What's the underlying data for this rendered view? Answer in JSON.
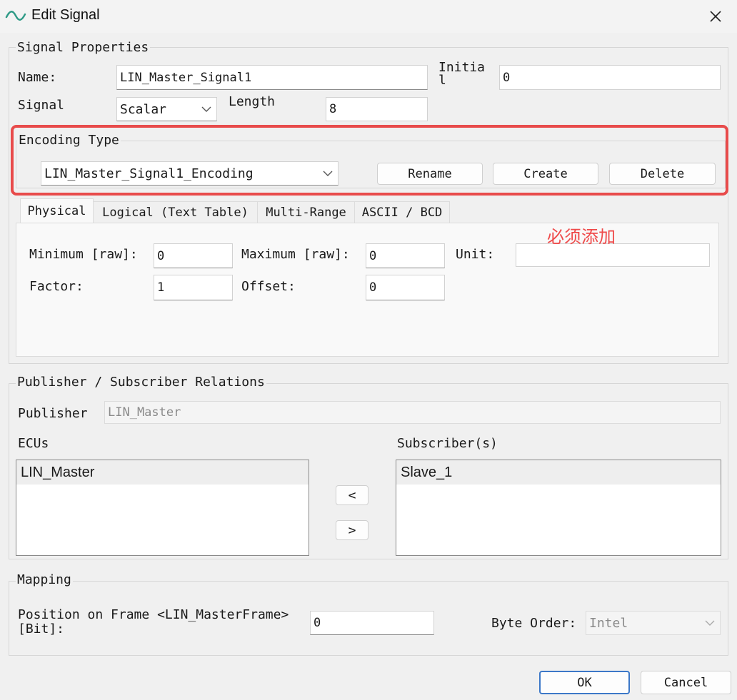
{
  "window": {
    "title": "Edit Signal",
    "app_icon": "wave-icon",
    "close_icon": "close-icon"
  },
  "signal_properties": {
    "group_label": "Signal Properties",
    "name_label": "Name:",
    "name_value": "LIN_Master_Signal1",
    "initial_label": "Initial",
    "initial_value": "0",
    "signal_label": "Signal",
    "signal_type": "Scalar",
    "length_label": "Length",
    "length_value": "8"
  },
  "encoding": {
    "group_label": "Encoding Type",
    "selected": "LIN_Master_Signal1_Encoding",
    "rename_label": "Rename",
    "create_label": "Create",
    "delete_label": "Delete",
    "highlight_color": "#e84b4b"
  },
  "tabs": [
    {
      "label": "Physical"
    },
    {
      "label": "Logical (Text Table)"
    },
    {
      "label": "Multi-Range"
    },
    {
      "label": "ASCII / BCD"
    }
  ],
  "physical": {
    "minimum_label": "Minimum [raw]:",
    "minimum_value": "0",
    "maximum_label": "Maximum [raw]:",
    "maximum_value": "0",
    "unit_label": "Unit:",
    "unit_value": "",
    "factor_label": "Factor:",
    "factor_value": "1",
    "offset_label": "Offset:",
    "offset_value": "0"
  },
  "annotation": {
    "text": "必须添加",
    "color": "#ef4a4a"
  },
  "relations": {
    "group_label": "Publisher / Subscriber Relations",
    "publisher_label": "Publisher",
    "publisher_value": "LIN_Master",
    "ecus_label": "ECUs",
    "ecus": [
      "LIN_Master"
    ],
    "subscribers_label": "Subscriber(s)",
    "subscribers": [
      "Slave_1"
    ],
    "move_left_label": "<",
    "move_right_label": ">"
  },
  "mapping": {
    "group_label": "Mapping",
    "position_label": "Position on Frame <LIN_MasterFrame> [Bit]:",
    "position_value": "0",
    "byte_order_label": "Byte Order:",
    "byte_order_value": "Intel"
  },
  "footer": {
    "ok_label": "OK",
    "cancel_label": "Cancel",
    "accent": "#3c78c8"
  }
}
